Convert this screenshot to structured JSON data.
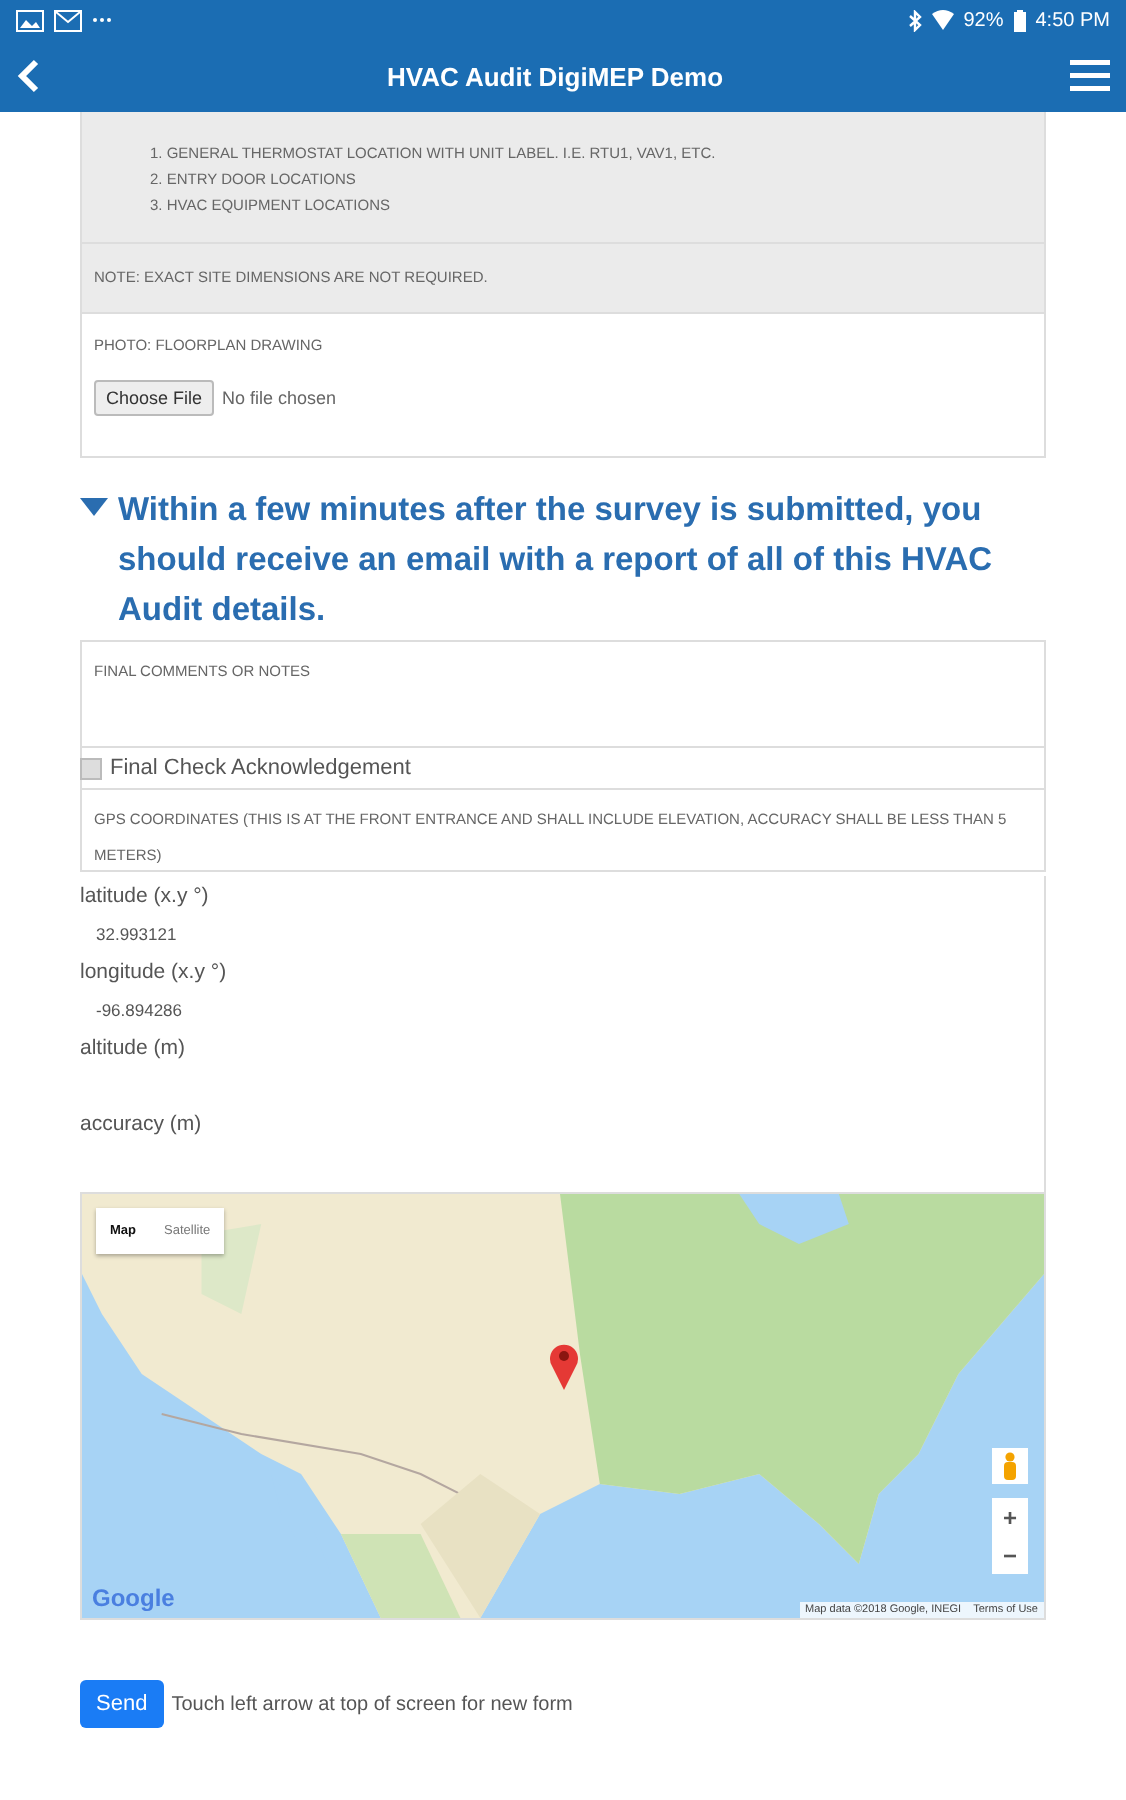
{
  "status_bar": {
    "battery": "92%",
    "time": "4:50 PM"
  },
  "app_bar": {
    "title": "HVAC Audit DigiMEP Demo"
  },
  "instructions": {
    "items": [
      "1. GENERAL THERMOSTAT LOCATION WITH UNIT LABEL. I.E. RTU1, VAV1, ETC.",
      "2. ENTRY DOOR LOCATIONS",
      "3. HVAC EQUIPMENT LOCATIONS"
    ],
    "note": "NOTE: EXACT SITE DIMENSIONS ARE NOT REQUIRED."
  },
  "photo": {
    "label": "PHOTO: FLOORPLAN DRAWING",
    "button": "Choose File",
    "status": "No file chosen"
  },
  "notice": {
    "expanded": true,
    "text": "Within a few minutes after the survey is submitted, you should receive an email with a report of all of this HVAC Audit details."
  },
  "comments": {
    "label": "FINAL COMMENTS OR NOTES"
  },
  "acknowledgement": {
    "label": "Final Check Acknowledgement",
    "checked": false
  },
  "gps": {
    "label": "GPS COORDINATES (THIS IS AT THE FRONT ENTRANCE AND SHALL INCLUDE ELEVATION, ACCURACY SHALL BE LESS THAN 5 METERS)",
    "fields": [
      {
        "label": "latitude (x.y °)",
        "value": "32.993121"
      },
      {
        "label": "longitude (x.y °)",
        "value": "-96.894286"
      },
      {
        "label": "altitude (m)"
      },
      {
        "label": "accuracy (m)"
      }
    ]
  },
  "map": {
    "types": [
      {
        "label": "Map",
        "selected": true
      },
      {
        "label": "Satellite",
        "selected": false
      }
    ],
    "zoom_in": "+",
    "zoom_out": "−",
    "logo": "Google",
    "attribution": "Map data ©2018 Google, INEGI",
    "terms": "Terms of Use"
  },
  "footer": {
    "button": "Send",
    "hint": "Touch left arrow at top of screen for new form"
  }
}
